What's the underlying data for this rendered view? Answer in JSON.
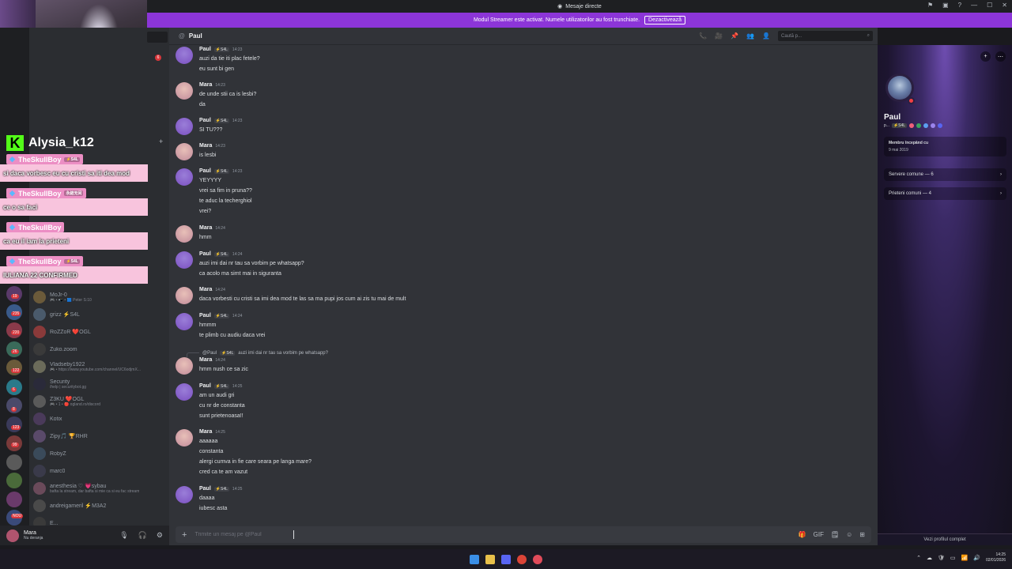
{
  "window": {
    "title": "Mesaje directe",
    "controls": [
      "⚑",
      "▣",
      "?",
      "—",
      "☐",
      "✕"
    ]
  },
  "banner": {
    "text": "Modul Streamer este activat. Numele utilizatorilor au fost trunchiate.",
    "button": "Dezactivează"
  },
  "stream_overlay": {
    "streamer_name": "Alysia_k12",
    "platform_logo": "K",
    "chat": [
      {
        "user": "TheSkullBoy",
        "tag": "⚡S4L",
        "message": "si daca vorbesc eu cu cristi sa iti dea mod"
      },
      {
        "user": "TheSkullBoy",
        "tag": "永結无间",
        "message": "ce o sa faci"
      },
      {
        "user": "TheSkullBoy",
        "tag": "",
        "message": "ca eu il iam la prieteni"
      },
      {
        "user": "TheSkullBoy",
        "tag": "⚡S4L",
        "message": "IULIANA 22 CONFIRMED"
      }
    ]
  },
  "server_rail": {
    "badges": [
      "19",
      "235",
      "220",
      "26",
      "122",
      "6",
      "8",
      "123",
      "99",
      "NOU"
    ]
  },
  "dm_list": {
    "items": [
      {
        "name": "MoJr-0",
        "sub": "🎮 • 📲 • 🟦 Peter S:10",
        "color": "#6b5a3a"
      },
      {
        "name": "grizz ⚡S4L",
        "sub": "",
        "color": "#4a5a6b"
      },
      {
        "name": "RoZZoR ❤️OGL",
        "sub": "",
        "color": "#8a3a3a"
      },
      {
        "name": "Zuko.zoom",
        "sub": "",
        "color": "#3a3a3a"
      },
      {
        "name": "Vladseby1922",
        "sub": "🎮 • https://www.youtube.com/channel/UC6odjmX...",
        "color": "#6b6b5a"
      },
      {
        "name": "Security",
        "sub": "/help | securitybot.gg",
        "color": "#2a2a3a"
      },
      {
        "name": "Z3KU ❤️OGL",
        "sub": "🎮 • 1 • 🔴 ogland.ro/discord",
        "color": "#5a5a5a"
      },
      {
        "name": "Kotix",
        "sub": "",
        "color": "#4a3a5a"
      },
      {
        "name": "Zipy🎵 🏆RHR",
        "sub": "",
        "color": "#5a4a6a"
      },
      {
        "name": "RobyZ",
        "sub": "",
        "color": "#3a4a5a"
      },
      {
        "name": "marc0",
        "sub": "",
        "color": "#3a3a4a"
      },
      {
        "name": "anesthesia ♡ 💗sybau",
        "sub": "bafta la stream, dar bafta si mie ca si eu fac stream",
        "color": "#6a4a5a"
      },
      {
        "name": "andreigameril ⚡M3A2",
        "sub": "",
        "color": "#4a4a4a"
      },
      {
        "name": "E...",
        "sub": "",
        "color": "#3a3a3a"
      }
    ]
  },
  "user_panel": {
    "name": "Mara",
    "status": "Nu deranja",
    "controls": [
      "🎙",
      "🎧",
      "⚙"
    ]
  },
  "channel": {
    "name": "Paul",
    "at_icon": "@",
    "search_placeholder": "Caută p...",
    "tools": [
      "📞",
      "🎥",
      "📌",
      "👥",
      "👤"
    ]
  },
  "messages": [
    {
      "author": "Paul",
      "tag": "⚡S4L",
      "time": "14:23",
      "lines": [
        "auzi da tie iti plac fetele?",
        "eu sunt bi gen"
      ],
      "avatar": "paul"
    },
    {
      "author": "Mara",
      "tag": "",
      "time": "14:23",
      "lines": [
        "de unde stii ca is lesbi?",
        "da"
      ],
      "avatar": "mara"
    },
    {
      "author": "Paul",
      "tag": "⚡S4L",
      "time": "14:23",
      "lines": [
        "SI TU???"
      ],
      "avatar": "paul"
    },
    {
      "author": "Mara",
      "tag": "",
      "time": "14:23",
      "lines": [
        "is lesbi"
      ],
      "avatar": "mara"
    },
    {
      "author": "Paul",
      "tag": "⚡S4L",
      "time": "14:23",
      "lines": [
        "YEYYYY",
        "vrei sa fim in pruna??",
        "te aduc la techerghiol",
        "vrei?"
      ],
      "avatar": "paul"
    },
    {
      "author": "Mara",
      "tag": "",
      "time": "14:24",
      "lines": [
        "hmm"
      ],
      "avatar": "mara"
    },
    {
      "author": "Paul",
      "tag": "⚡S4L",
      "time": "14:24",
      "lines": [
        "auzi imi dai nr tau sa vorbim pe whatsapp?",
        "ca acolo ma simt mai in siguranta"
      ],
      "avatar": "paul"
    },
    {
      "author": "Mara",
      "tag": "",
      "time": "14:24",
      "lines": [
        "daca vorbesti cu cristi sa imi dea mod te las sa ma pupi jos cum ai zis tu mai de mult"
      ],
      "avatar": "mara"
    },
    {
      "author": "Paul",
      "tag": "⚡S4L",
      "time": "14:24",
      "lines": [
        "hmmm",
        "te plimb cu audiu daca vrei"
      ],
      "avatar": "paul"
    },
    {
      "author": "Mara",
      "tag": "",
      "time": "14:24",
      "lines": [
        "hmm nush ce sa zic"
      ],
      "avatar": "mara"
    },
    {
      "author": "Paul",
      "tag": "⚡S4L",
      "time": "14:25",
      "lines": [
        "am un audi gri",
        "cu nr de constanta",
        "sunt prietenoasa!!"
      ],
      "avatar": "paul"
    },
    {
      "author": "Mara",
      "tag": "",
      "time": "14:25",
      "lines": [
        "aaaaaa",
        "constanta",
        "alergi cumva in fie care seara pe langa mare?",
        "cred ca te am vazut"
      ],
      "avatar": "mara"
    },
    {
      "author": "Paul",
      "tag": "⚡S4L",
      "time": "14:25",
      "lines": [
        "daaaa",
        "iubesc asta"
      ],
      "avatar": "paul"
    }
  ],
  "reply_reference": {
    "user": "@Paul",
    "tag": "⚡S4L",
    "text": "auzi imi dai nr tau sa vorbim pe whatsapp?"
  },
  "composer": {
    "placeholder": "Trimite un mesaj pe @Paul",
    "plus": "+",
    "tools": [
      "🎁",
      "GIF",
      "🗒",
      "☺",
      "⊞"
    ]
  },
  "profile": {
    "name": "Paul",
    "sub_prefix": "p...",
    "tag": "⚡S4L",
    "member_since_label": "Membru începând cu",
    "member_since_value": "9 mai 2019",
    "common_servers": "Servere comune — 6",
    "common_friends": "Prieteni comuni — 4",
    "footer": "Vezi profilul complet",
    "badge_colors": [
      "#f0607a",
      "#3ba55d",
      "#5c9ef0",
      "#9b84ec",
      "#5865f2"
    ]
  },
  "taskbar": {
    "time": "14:25",
    "date": "02/01/2026",
    "tray_icons": [
      "⌃",
      "☁",
      "🛡",
      "▭",
      "📶",
      "🔊"
    ]
  },
  "colors": {
    "accent": "#8c35d8",
    "paul_avatar": "#7a4fc0",
    "mara_avatar": "#c08a9a"
  }
}
